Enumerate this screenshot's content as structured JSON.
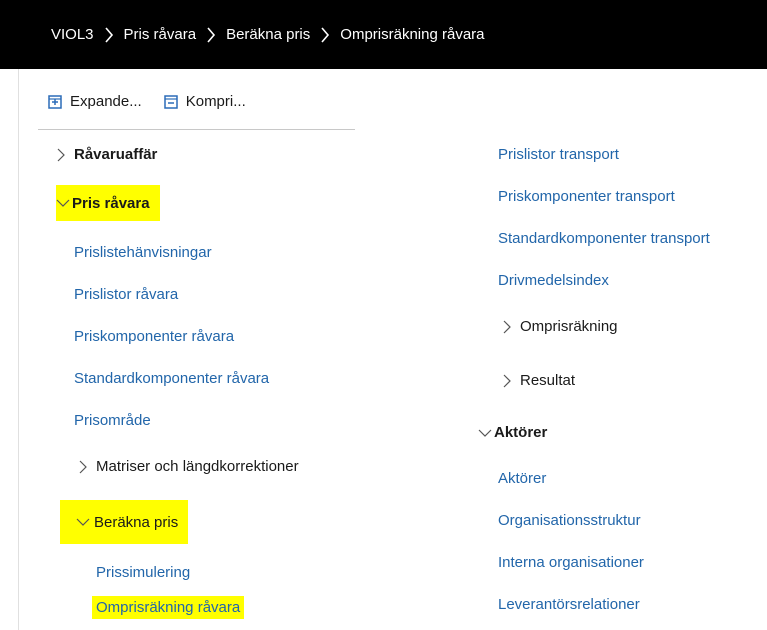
{
  "breadcrumb": [
    "VIOL3",
    "Pris råvara",
    "Beräkna pris",
    "Omprisräkning råvara"
  ],
  "toolbar": {
    "expand_label": "Expande...",
    "collapse_label": "Kompri..."
  },
  "left": {
    "group_ravaruaffar": "Råvaruaffär",
    "group_pris_ravara": "Pris råvara",
    "links": [
      "Prislistehänvisningar",
      "Prislistor råvara",
      "Priskomponenter råvara",
      "Standardkomponenter råvara",
      "Prisområde"
    ],
    "group_matriser": "Matriser och längdkorrektioner",
    "group_berakna_pris": "Beräkna pris",
    "sublinks": [
      "Prissimulering",
      "Omprisräkning råvara"
    ]
  },
  "right": {
    "links_top": [
      "Prislistor transport",
      "Priskomponenter transport",
      "Standardkomponenter transport",
      "Drivmedelsindex"
    ],
    "group_omprisrakning": "Omprisräkning",
    "group_resultat": "Resultat",
    "group_aktorer": "Aktörer",
    "links_bottom": [
      "Aktörer",
      "Organisationsstruktur",
      "Interna organisationer",
      "Leverantörsrelationer"
    ]
  },
  "colors": {
    "link": "#2266aa",
    "highlight": "#ffff00",
    "topbar": "#000000",
    "icon": "#2b6cb8"
  },
  "icons": {
    "expand": "plus-square-icon",
    "collapse": "minus-square-icon",
    "breadcrumb_separator": "chevron-right-icon",
    "collapsed": "chevron-right-icon",
    "expanded": "chevron-down-icon"
  }
}
